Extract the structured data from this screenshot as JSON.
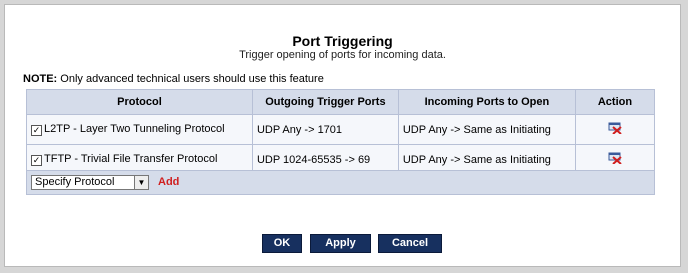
{
  "header": {
    "title": "Port Triggering",
    "subtitle": "Trigger opening of ports for incoming data."
  },
  "note": {
    "label": "NOTE:",
    "text": " Only advanced technical users should use this feature"
  },
  "table": {
    "columns": [
      "Protocol",
      "Outgoing Trigger Ports",
      "Incoming Ports to Open",
      "Action"
    ],
    "rows": [
      {
        "checked": true,
        "protocol": "L2TP - Layer Two Tunneling Protocol",
        "outgoing": "UDP Any -> 1701",
        "incoming": "UDP Any -> Same as Initiating",
        "action_icon": "delete-icon"
      },
      {
        "checked": true,
        "protocol": "TFTP - Trivial File Transfer Protocol",
        "outgoing": "UDP 1024-65535 -> 69",
        "incoming": "UDP Any -> Same as Initiating",
        "action_icon": "delete-icon"
      }
    ]
  },
  "add_row": {
    "select_value": "Specify Protocol",
    "add_label": "Add"
  },
  "buttons": {
    "ok": "OK",
    "apply": "Apply",
    "cancel": "Cancel"
  },
  "colors": {
    "button_bg": "#17305f",
    "add_link": "#d01e1e",
    "header_bg": "#d5dcea"
  }
}
